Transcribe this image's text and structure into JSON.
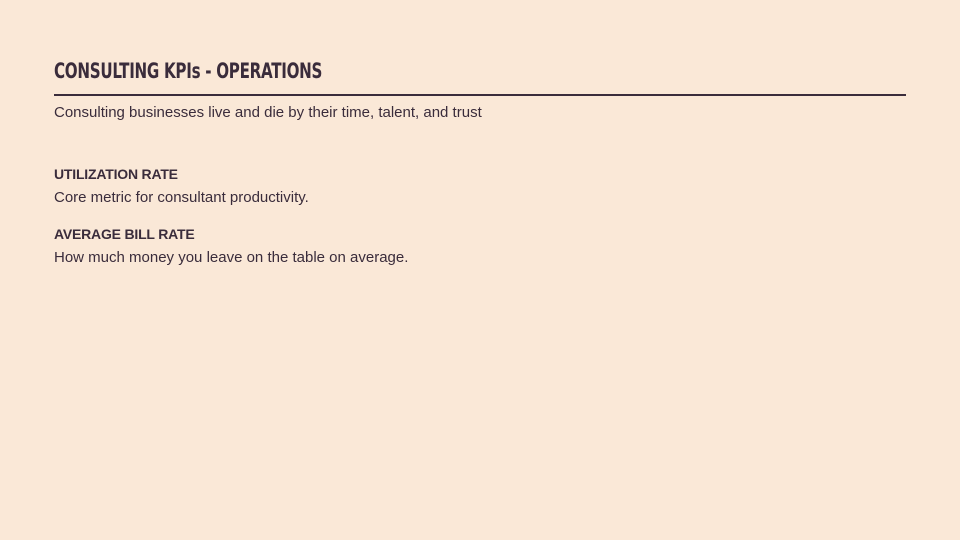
{
  "slide": {
    "title": "CONSULTING KPIs - OPERATIONS",
    "subtitle": "Consulting businesses live and die by their time, talent, and trust",
    "kpis": [
      {
        "name": "UTILIZATION RATE",
        "description": "Core metric for consultant productivity."
      },
      {
        "name": "AVERAGE BILL RATE",
        "description": "How much money you leave on the table on average."
      }
    ]
  },
  "colors": {
    "background": "#fae8d7",
    "text": "#3a2c3b",
    "rule": "#3a2c3b"
  }
}
